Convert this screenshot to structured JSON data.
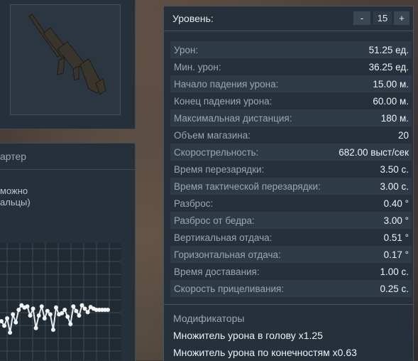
{
  "left": {
    "header_fragment": "артер",
    "desc_line1": " можно",
    "desc_line2": "альцы)"
  },
  "chart_data": {
    "type": "line",
    "x": [
      1,
      2,
      3,
      4,
      5,
      6,
      7,
      8,
      9,
      10,
      11,
      12,
      13,
      14,
      15,
      16,
      17,
      18,
      19,
      20,
      21,
      22,
      23,
      24,
      25,
      26,
      27,
      28,
      29,
      30,
      31,
      32,
      33,
      34,
      35,
      36,
      37,
      38
    ],
    "values": [
      0.5,
      0.42,
      0.55,
      0.3,
      0.62,
      0.48,
      0.7,
      0.78,
      0.74,
      0.76,
      0.6,
      0.72,
      0.38,
      0.6,
      0.76,
      0.55,
      0.68,
      0.62,
      0.35,
      0.74,
      0.62,
      0.64,
      0.7,
      0.58,
      0.45,
      0.76,
      0.68,
      0.6,
      0.78,
      0.72,
      0.66,
      0.75,
      0.72,
      0.7,
      0.7,
      0.7,
      0.7,
      0.7
    ]
  },
  "panel": {
    "level_label": "Уровень:",
    "level_minus": "-",
    "level_value": "15",
    "level_plus": "+",
    "stats": [
      {
        "name": "Урон:",
        "value": "51.25 ед."
      },
      {
        "name": "Мин. урон:",
        "value": "36.25 ед."
      },
      {
        "name": "Начало падения урона:",
        "value": "15.00 м."
      },
      {
        "name": "Конец падения урона:",
        "value": "60.00 м."
      },
      {
        "name": "Максимальная дистанция:",
        "value": "180 м."
      },
      {
        "name": "Объем магазина:",
        "value": "20"
      },
      {
        "name": "Скорострельность:",
        "value": "682.00 выст/сек"
      },
      {
        "name": "Время перезарядки:",
        "value": "3.50 с."
      },
      {
        "name": "Время тактической перезарядки:",
        "value": "3.00 с."
      },
      {
        "name": "Разброс:",
        "value": "0.40 °"
      },
      {
        "name": "Разброс от бедра:",
        "value": "3.00 °"
      },
      {
        "name": "Вертикальная отдача:",
        "value": "0.51 °"
      },
      {
        "name": "Горизонтальная отдача:",
        "value": "0.17 °"
      },
      {
        "name": "Время доставания:",
        "value": "1.00 с."
      },
      {
        "name": "Скорость прицеливания:",
        "value": "0.25 с."
      }
    ],
    "modifiers_title": "Модификаторы",
    "modifiers": [
      "Множитель урона в голову x1.25",
      "Множитель урона по конечностям x0.63"
    ]
  }
}
